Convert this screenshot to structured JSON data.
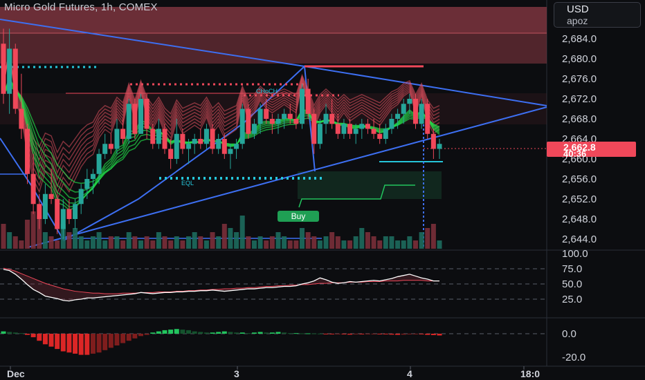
{
  "header": {
    "title": "Micro Gold Futures, 1h, COMEX",
    "currency": "USD",
    "unit": "apoz"
  },
  "price_tag": {
    "price": "2,662.8",
    "countdown": "40:36"
  },
  "signals": {
    "buy": "Buy",
    "choch": "CHoCH",
    "eql": "EQL"
  },
  "colors": {
    "background": "#0c0d10",
    "bull": "#26a69a",
    "bear": "#f0485a",
    "trendline": "#3d6ff2",
    "supply_zone": "#8b3a44",
    "oscillator_line": "#ffffff",
    "oscillator_signal": "#f0485a",
    "hist_up": "#22c55e",
    "hist_down": "#dc2626"
  },
  "chart_data": [
    {
      "type": "candlestick",
      "title": "Micro Gold Futures, 1h, COMEX",
      "y_ticks": [
        "2,684.0",
        "2,680.0",
        "2,676.0",
        "2,672.0",
        "2,668.0",
        "2,664.0",
        "2,660.0",
        "2,656.0",
        "2,652.0",
        "2,648.0",
        "2,644.0"
      ],
      "ylim": [
        2643.0,
        2690.0
      ],
      "x_ticks": [
        "Dec",
        "3",
        "4",
        "18:0"
      ],
      "ohlc": [
        [
          2683,
          2686,
          2671,
          2673
        ],
        [
          2673,
          2686,
          2669,
          2682
        ],
        [
          2682,
          2683,
          2669,
          2670
        ],
        [
          2670,
          2677,
          2664,
          2666
        ],
        [
          2666,
          2667,
          2655,
          2657
        ],
        [
          2657,
          2661,
          2649,
          2651
        ],
        [
          2651,
          2653,
          2646,
          2648
        ],
        [
          2648,
          2655,
          2647,
          2653
        ],
        [
          2653,
          2658,
          2651,
          2652
        ],
        [
          2652,
          2653,
          2645,
          2646
        ],
        [
          2646,
          2652,
          2644,
          2650
        ],
        [
          2650,
          2652,
          2647,
          2648
        ],
        [
          2648,
          2652,
          2646,
          2651
        ],
        [
          2651,
          2655,
          2649,
          2654
        ],
        [
          2654,
          2658,
          2652,
          2656
        ],
        [
          2656,
          2658,
          2653,
          2657
        ],
        [
          2657,
          2662,
          2655,
          2661
        ],
        [
          2661,
          2665,
          2660,
          2663
        ],
        [
          2663,
          2665,
          2661,
          2662
        ],
        [
          2662,
          2668,
          2661,
          2666
        ],
        [
          2666,
          2668,
          2663,
          2664
        ],
        [
          2664,
          2672,
          2663,
          2671
        ],
        [
          2671,
          2672,
          2664,
          2665
        ],
        [
          2665,
          2673,
          2665,
          2672
        ],
        [
          2672,
          2673,
          2664,
          2666
        ],
        [
          2666,
          2667,
          2662,
          2663
        ],
        [
          2663,
          2668,
          2662,
          2666
        ],
        [
          2666,
          2667,
          2661,
          2662
        ],
        [
          2662,
          2664,
          2658,
          2660
        ],
        [
          2660,
          2668,
          2659,
          2665
        ],
        [
          2665,
          2666,
          2661,
          2662
        ],
        [
          2662,
          2664,
          2659,
          2663
        ],
        [
          2663,
          2665,
          2661,
          2664
        ],
        [
          2664,
          2666,
          2662,
          2663
        ],
        [
          2663,
          2667,
          2662,
          2666
        ],
        [
          2666,
          2667,
          2661,
          2662
        ],
        [
          2662,
          2665,
          2661,
          2664
        ],
        [
          2664,
          2665,
          2660,
          2661
        ],
        [
          2661,
          2663,
          2658,
          2662
        ],
        [
          2662,
          2664,
          2660,
          2663
        ],
        [
          2663,
          2671,
          2662,
          2670
        ],
        [
          2670,
          2671,
          2664,
          2665
        ],
        [
          2665,
          2668,
          2664,
          2667
        ],
        [
          2667,
          2671,
          2665,
          2670
        ],
        [
          2670,
          2672,
          2667,
          2668
        ],
        [
          2668,
          2669,
          2665,
          2667
        ],
        [
          2667,
          2669,
          2665,
          2668
        ],
        [
          2668,
          2670,
          2666,
          2669
        ],
        [
          2669,
          2671,
          2667,
          2668
        ],
        [
          2668,
          2670,
          2666,
          2667
        ],
        [
          2667,
          2675,
          2666,
          2674
        ],
        [
          2674,
          2676,
          2668,
          2669
        ],
        [
          2669,
          2670,
          2661,
          2663
        ],
        [
          2663,
          2668,
          2662,
          2667
        ],
        [
          2667,
          2671,
          2665,
          2669
        ],
        [
          2669,
          2672,
          2666,
          2667
        ],
        [
          2667,
          2669,
          2664,
          2665
        ],
        [
          2665,
          2668,
          2664,
          2667
        ],
        [
          2667,
          2668,
          2664,
          2665
        ],
        [
          2665,
          2667,
          2663,
          2666
        ],
        [
          2666,
          2668,
          2664,
          2667
        ],
        [
          2667,
          2668,
          2665,
          2666
        ],
        [
          2666,
          2668,
          2664,
          2665
        ],
        [
          2665,
          2667,
          2663,
          2664
        ],
        [
          2664,
          2667,
          2663,
          2666
        ],
        [
          2666,
          2669,
          2665,
          2668
        ],
        [
          2668,
          2670,
          2666,
          2669
        ],
        [
          2669,
          2672,
          2667,
          2671
        ],
        [
          2671,
          2673,
          2669,
          2672
        ],
        [
          2672,
          2673,
          2666,
          2667
        ],
        [
          2667,
          2672,
          2666,
          2671
        ],
        [
          2671,
          2672,
          2664,
          2665
        ],
        [
          2665,
          2666,
          2660,
          2662
        ],
        [
          2662,
          2664,
          2660,
          2663
        ]
      ],
      "volume": [
        6,
        4,
        3,
        2,
        7,
        9,
        8,
        4,
        3,
        2,
        6,
        4,
        5,
        3,
        2,
        3,
        4,
        2,
        3,
        3,
        2,
        4,
        3,
        2,
        3,
        2,
        4,
        3,
        2,
        3,
        2,
        3,
        4,
        3,
        2,
        4,
        3,
        6,
        5,
        4,
        8,
        3,
        2,
        3,
        2,
        3,
        4,
        3,
        2,
        2,
        5,
        4,
        3,
        2,
        3,
        4,
        3,
        2,
        2,
        3,
        5,
        4,
        3,
        2,
        3,
        3,
        2,
        2,
        3,
        2,
        4,
        5,
        6,
        2
      ]
    },
    {
      "type": "line",
      "y_ticks": [
        "100.0",
        "75.0",
        "50.0",
        "25.0"
      ],
      "ylim": [
        0,
        100
      ],
      "series": [
        {
          "values": [
            74,
            72,
            66,
            58,
            49,
            41,
            36,
            30,
            28,
            26,
            23,
            22,
            24,
            25,
            27,
            27,
            28,
            29,
            30,
            31,
            32,
            33,
            34,
            36,
            35,
            34,
            35,
            36,
            36,
            37,
            37,
            38,
            38,
            39,
            39,
            40,
            39,
            38,
            39,
            40,
            41,
            42,
            42,
            43,
            44,
            44,
            45,
            46,
            46,
            47,
            50,
            52,
            55,
            60,
            57,
            53,
            51,
            52,
            54,
            53,
            54,
            55,
            56,
            55,
            57,
            59,
            62,
            64,
            66,
            63,
            60,
            58,
            55,
            55
          ]
        },
        {
          "values": [
            76,
            74,
            71,
            67,
            63,
            59,
            55,
            51,
            48,
            45,
            42,
            40,
            38,
            37,
            36,
            35,
            35,
            34,
            34,
            34,
            35,
            35,
            35,
            36,
            36,
            36,
            37,
            37,
            37,
            38,
            38,
            39,
            39,
            40,
            40,
            41,
            41,
            42,
            42,
            43,
            43,
            44,
            44,
            45,
            46,
            46,
            47,
            47,
            48,
            48,
            49,
            49,
            50,
            51,
            51,
            52,
            52,
            52,
            53,
            53,
            53,
            54,
            54,
            54,
            55,
            55,
            55,
            56,
            56,
            56,
            56,
            55,
            55,
            55
          ]
        }
      ]
    },
    {
      "type": "bar",
      "y_ticks": [
        "0.0",
        "-20.0"
      ],
      "ylim": [
        -25,
        5
      ],
      "values": [
        2,
        1.5,
        1,
        0.5,
        -1,
        -3,
        -6,
        -9,
        -11,
        -13,
        -15,
        -16,
        -17,
        -18,
        -18,
        -17,
        -16,
        -14,
        -12,
        -10,
        -8,
        -6,
        -4,
        -2,
        -1,
        1,
        2,
        3,
        3.5,
        4,
        3.5,
        3,
        2,
        1.5,
        1,
        1,
        1.5,
        2,
        1.5,
        1,
        1,
        0.5,
        1,
        1.5,
        1,
        1,
        1.5,
        1,
        0.5,
        0.5,
        0.3,
        0.3,
        0.2,
        0.1,
        -0.3,
        -0.5,
        -0.3,
        -0.5,
        -0.8,
        -0.5,
        -0.5,
        -0.3,
        -0.2,
        -0.3,
        -0.5,
        -0.8,
        -1,
        -0.8,
        -0.5,
        -0.3,
        -0.5,
        -1,
        -1.2,
        -1.5
      ]
    }
  ]
}
